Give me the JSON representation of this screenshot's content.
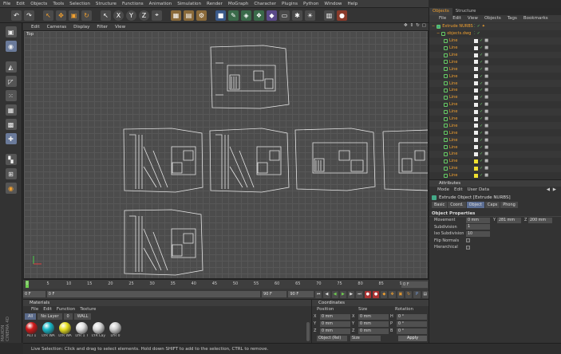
{
  "menubar": [
    "File",
    "Edit",
    "Objects",
    "Tools",
    "Selection",
    "Structure",
    "Functions",
    "Animation",
    "Simulation",
    "Render",
    "MoGraph",
    "Character",
    "Plugins",
    "Python",
    "Window",
    "Help"
  ],
  "toolbar": {
    "icons": [
      "undo-icon",
      "redo-icon",
      "live-selection-icon",
      "move-icon",
      "scale-icon",
      "rotate-icon",
      "select-tool-icon",
      "x-axis-icon",
      "y-axis-icon",
      "z-axis-icon",
      "coordinate-system-icon",
      "render-view-icon",
      "render-picture-viewer-icon",
      "edit-render-settings-icon",
      "cube-icon",
      "pen-spline-icon",
      "subdivision-surface-icon",
      "array-icon",
      "deformer-icon",
      "scene-floor-icon",
      "camera-icon",
      "light-icon",
      "layout-icon",
      "script-icon"
    ],
    "axis_x": "X",
    "axis_y": "Y",
    "axis_z": "Z"
  },
  "left_tools": [
    "make-editable-icon",
    "model-mode-icon",
    "texture-mode-icon",
    "workplane-icon",
    "points-mode-icon",
    "edges-mode-icon",
    "polygons-mode-icon",
    "axis-mode-icon",
    "tweak-mode-icon",
    "snap-icon",
    "solo-icon"
  ],
  "logo": "MAXON CINEMA 4D",
  "viewport": {
    "menu": [
      "Edit",
      "Cameras",
      "Display",
      "Filter",
      "View"
    ],
    "label": "Top",
    "nav_icons": [
      "move-view-icon",
      "zoom-view-icon",
      "rotate-view-icon",
      "maximize-view-icon"
    ]
  },
  "timeline": {
    "ticks": [
      "0",
      "5",
      "10",
      "15",
      "20",
      "25",
      "30",
      "35",
      "40",
      "45",
      "50",
      "55",
      "60",
      "65",
      "70",
      "75",
      "80",
      "85",
      "90"
    ],
    "current_frame_right": "0 F",
    "start_frame": "0 F",
    "start_field": "0 F",
    "end_field": "90 F",
    "end_frame": "90 F"
  },
  "materials": {
    "header": "Materials",
    "menu": [
      "File",
      "Edit",
      "Function",
      "Texture"
    ],
    "tabs": [
      "All",
      "No Layer",
      "0",
      "WALL"
    ],
    "items": [
      {
        "label": "ACI 1",
        "color": "#d01818"
      },
      {
        "label": "LYR WA",
        "color": "#18b8c8"
      },
      {
        "label": "LYR WA",
        "color": "#e8e020"
      },
      {
        "label": "LYR 1 T",
        "color": "#e0e0e0"
      },
      {
        "label": "LYR Lay",
        "color": "#d8d8d8"
      },
      {
        "label": "LYR 0",
        "color": "#cfcfcf"
      }
    ]
  },
  "coordinates": {
    "header": "Coordinates",
    "columns": [
      "Position",
      "Size",
      "Rotation"
    ],
    "rows": [
      {
        "axis": "X",
        "pos": "0 mm",
        "size_axis": "X",
        "size": "0 mm",
        "rot_axis": "H",
        "rot": "0 °"
      },
      {
        "axis": "Y",
        "pos": "0 mm",
        "size_axis": "Y",
        "size": "0 mm",
        "rot_axis": "P",
        "rot": "0 °"
      },
      {
        "axis": "Z",
        "pos": "0 mm",
        "size_axis": "Z",
        "size": "0 mm",
        "rot_axis": "B",
        "rot": "0 °"
      }
    ],
    "mode_dropdown": "Object (Rel)",
    "size_dropdown": "Size",
    "apply": "Apply"
  },
  "status": "Live Selection: Click and drag to select elements. Hold down SHIFT to add to the selection, CTRL to remove.",
  "objects": {
    "tabs": [
      "Objects",
      "Structure"
    ],
    "menu": [
      "File",
      "Edit",
      "View",
      "Objects",
      "Tags",
      "Bookmarks"
    ],
    "root": "Extrude NURBS",
    "child": "objects.dwg",
    "lines": [
      "Line",
      "Line",
      "Line",
      "Line",
      "Line",
      "Line",
      "Line",
      "Line",
      "Line",
      "Line",
      "Line",
      "Line",
      "Line",
      "Line",
      "Line",
      "Line",
      "Line",
      "Line",
      "Line",
      "Line"
    ]
  },
  "attributes": {
    "header": "Attributes",
    "menu": [
      "Mode",
      "Edit",
      "User Data"
    ],
    "title": "Extrude Object [Extrude NURBS]",
    "tabs": [
      "Basic",
      "Coord.",
      "Object",
      "Caps",
      "Phong"
    ],
    "section": "Object Properties",
    "movement_label": "Movement",
    "movement": [
      "0 mm",
      "281 mm",
      "200 mm"
    ],
    "movement_axes": [
      "",
      "Y",
      "Z"
    ],
    "subdivision_label": "Subdivision",
    "subdivision": "1",
    "iso_label": "Iso Subdivision",
    "iso": "10",
    "flip_label": "Flip Normals",
    "hier_label": "Hierarchical"
  }
}
